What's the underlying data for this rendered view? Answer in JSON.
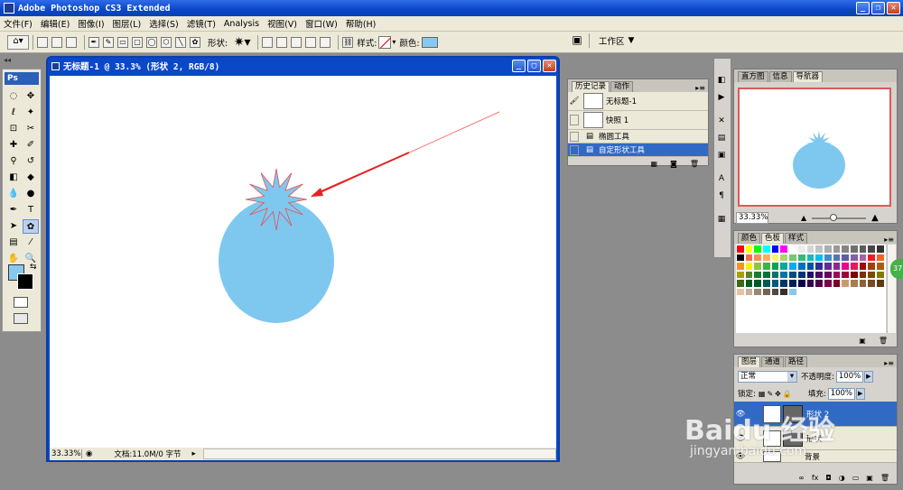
{
  "window": {
    "title": "Adobe Photoshop CS3 Extended",
    "icon": "photoshop-icon"
  },
  "menu": [
    "文件(F)",
    "编辑(E)",
    "图像(I)",
    "图层(L)",
    "选择(S)",
    "滤镜(T)",
    "Analysis",
    "视图(V)",
    "窗口(W)",
    "帮助(H)"
  ],
  "options": {
    "shape_label": "形状:",
    "style_label": "样式:",
    "color_label": "颜色:",
    "workspace_label": "工作区",
    "colors": {
      "fill": "#86c9f0"
    }
  },
  "document": {
    "title": "无标题-1 @ 33.3% (形状 2, RGB/8)",
    "zoom": "33.33%",
    "status": "文档:11.0M/0 字节",
    "shape_color": "#7ec8f0",
    "arrow_color": "#e82020"
  },
  "history": {
    "tabs": [
      "历史记录",
      "动作"
    ],
    "rows": [
      {
        "label": "无标题-1"
      },
      {
        "label": "快照 1"
      },
      {
        "label": "椭圆工具"
      },
      {
        "label": "自定形状工具"
      }
    ]
  },
  "navigator": {
    "tabs": [
      "直方图",
      "信息",
      "导航器"
    ],
    "zoom": "33.33%"
  },
  "swatches": {
    "tabs": [
      "颜色",
      "色板",
      "样式"
    ]
  },
  "layers": {
    "tabs": [
      "图层",
      "通道",
      "路径"
    ],
    "blend_mode": "正常",
    "opacity_label": "不透明度:",
    "opacity": "100%",
    "lock_label": "锁定:",
    "fill_label": "填充:",
    "fill": "100%",
    "items": [
      {
        "name": "形状 2"
      },
      {
        "name": "形状"
      },
      {
        "name": "背景"
      }
    ]
  },
  "watermark": {
    "text": "Baidu 经验",
    "url": "jingyan.baidu.com"
  }
}
